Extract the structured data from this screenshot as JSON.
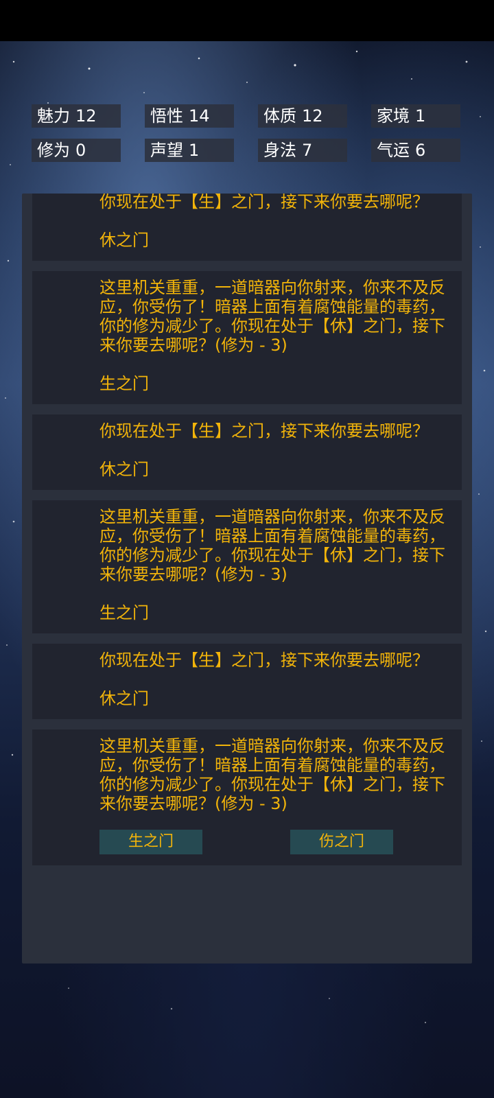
{
  "stats": [
    {
      "label": "魅力",
      "value": "12"
    },
    {
      "label": "悟性",
      "value": "14"
    },
    {
      "label": "体质",
      "value": "12"
    },
    {
      "label": "家境",
      "value": "1"
    },
    {
      "label": "修为",
      "value": "0"
    },
    {
      "label": "声望",
      "value": "1"
    },
    {
      "label": "身法",
      "value": "7"
    },
    {
      "label": "气运",
      "value": "6"
    }
  ],
  "events": [
    {
      "text": "你现在处于【生】之门，接下来你要去哪呢？",
      "choice": "休之门"
    },
    {
      "text": "这里机关重重，一道暗器向你射来，你来不及反应，你受伤了！暗器上面有着腐蚀能量的毒药，你的修为减少了。你现在处于【休】之门，接下来你要去哪呢？(修为 - 3)",
      "choice": "生之门"
    },
    {
      "text": "你现在处于【生】之门，接下来你要去哪呢？",
      "choice": "休之门"
    },
    {
      "text": "这里机关重重，一道暗器向你射来，你来不及反应，你受伤了！暗器上面有着腐蚀能量的毒药，你的修为减少了。你现在处于【休】之门，接下来你要去哪呢？(修为 - 3)",
      "choice": "生之门"
    },
    {
      "text": "你现在处于【生】之门，接下来你要去哪呢？",
      "choice": "休之门"
    }
  ],
  "current_event": {
    "text": "这里机关重重，一道暗器向你射来，你来不及反应，你受伤了！暗器上面有着腐蚀能量的毒药，你的修为减少了。你现在处于【休】之门，接下来你要去哪呢？(修为 - 3)",
    "options": [
      "生之门",
      "伤之门"
    ]
  },
  "colors": {
    "accent_text": "#f2b40a",
    "card_bg": "#21242f",
    "panel_bg": "#2b303c",
    "button_bg": "#264a52"
  }
}
